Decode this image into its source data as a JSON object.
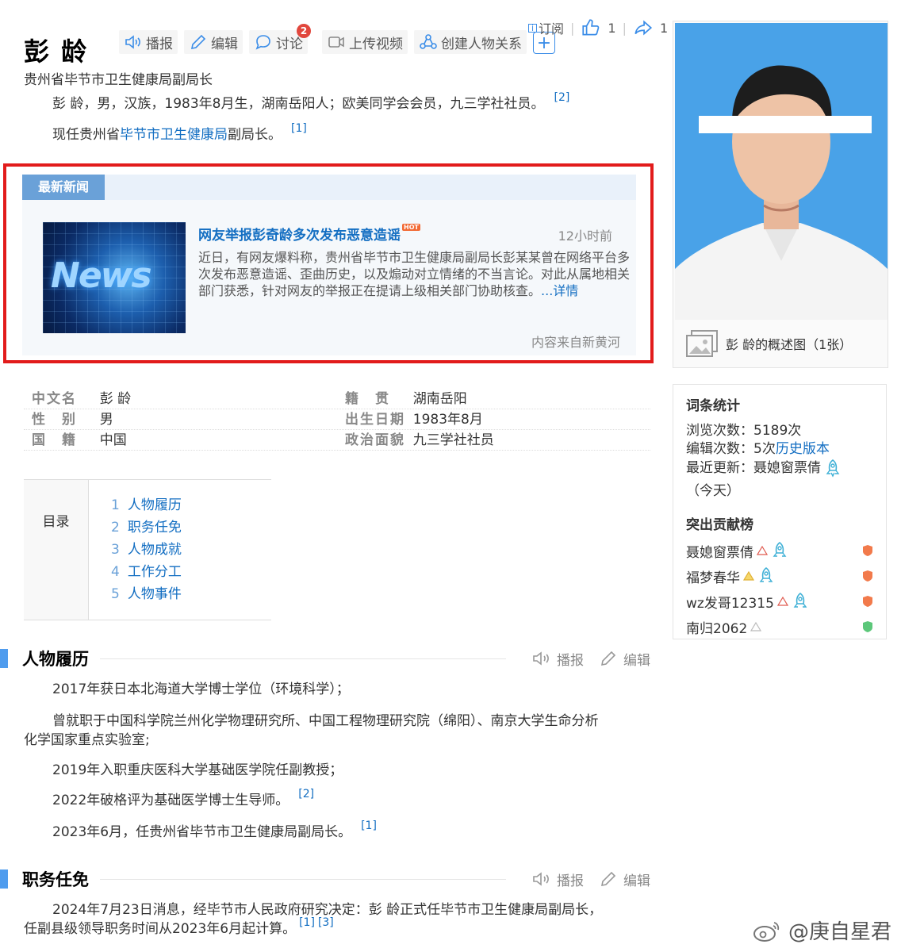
{
  "header": {
    "title": "彭 龄",
    "subtitle": "贵州省毕节市卫生健康局副局长",
    "actions": {
      "broadcast": "播报",
      "edit": "编辑",
      "discuss": "讨论",
      "discuss_badge": "2",
      "upload_video": "上传视频",
      "create_relation": "创建人物关系"
    },
    "subscribe": "订阅",
    "like_count": "1",
    "share_count": "1"
  },
  "summary": {
    "line1": "彭 龄，男，汉族，1983年8月生，湖南岳阳人；欧美同学会会员，九三学社社员。",
    "line1_ref": "[2]",
    "line2_pre": "现任贵州省",
    "line2_link": "毕节市卫生健康局",
    "line2_post": "副局长。",
    "line2_ref": "[1]"
  },
  "news": {
    "tag": "最新新闻",
    "image_text": "News",
    "headline": "网友举报彭奇龄多次发布恶意造谣",
    "hot": "HOT",
    "time": "12小时前",
    "body": "近日，有网友爆料称，贵州省毕节市卫生健康局副局长彭某某曾在网络平台多次发布恶意造谣、歪曲历史，以及煽动对立情绪的不当言论。对此从属地相关部门获悉，针对网友的举报正在提请上级相关部门协助核查。",
    "more": "...详情",
    "source": "内容来自新黄河"
  },
  "info": [
    {
      "k1": "中文名",
      "v1": "彭 龄",
      "k2": "籍　贯",
      "v2": "湖南岳阳"
    },
    {
      "k1": "性　别",
      "v1": "男",
      "k2": "出生日期",
      "v2": "1983年8月"
    },
    {
      "k1": "国　籍",
      "v1": "中国",
      "k2": "政治面貌",
      "v2": "九三学社社员"
    }
  ],
  "toc": {
    "label": "目录",
    "items": [
      {
        "num": "1",
        "text": "人物履历"
      },
      {
        "num": "2",
        "text": "职务任免"
      },
      {
        "num": "3",
        "text": "人物成就"
      },
      {
        "num": "4",
        "text": "工作分工"
      },
      {
        "num": "5",
        "text": "人物事件"
      }
    ]
  },
  "section1": {
    "title": "人物履历",
    "broadcast": "播报",
    "edit": "编辑",
    "p1": "2017年获日本北海道大学博士学位（环境科学）；",
    "p2a": "曾就职于中国科学院兰州化学物理研究所、中国工程物理研究院（绵阳）、南京大学生命分析",
    "p2b": "化学国家重点实验室;",
    "p3": "2019年入职重庆医科大学基础医学院任副教授；",
    "p4": "2022年破格评为基础医学博士生导师。",
    "p4_ref": "[2]",
    "p5": "2023年6月，任贵州省毕节市卫生健康局副局长。",
    "p5_ref": "[1]"
  },
  "section2": {
    "title": "职务任免",
    "broadcast": "播报",
    "edit": "编辑",
    "p1a": "2024年7月23日消息，经毕节市人民政府研究决定：彭 龄正式任毕节市卫生健康局副局长，",
    "p1b": "任副县级领导职务时间从2023年6月起计算。",
    "p1_ref1": "[1]",
    "p1_ref2": "[3]"
  },
  "photo": {
    "caption": "彭 龄的概述图（1张）"
  },
  "stats": {
    "title": "词条统计",
    "views": "浏览次数：5189次",
    "edits_pre": "编辑次数：5次",
    "edits_link": "历史版本",
    "updated": "最近更新：聂媳窗票倩",
    "updated_when": "（今天）",
    "contrib_title": "突出贡献榜",
    "contributors": [
      "聂媳窗票倩",
      "福梦春华",
      "wz发哥12315",
      "南归2062"
    ]
  },
  "watermark": "@庚自星君",
  "colors": {
    "link": "#136ec2",
    "accent": "#4f9cee",
    "highlight_border": "#e21b1b"
  }
}
